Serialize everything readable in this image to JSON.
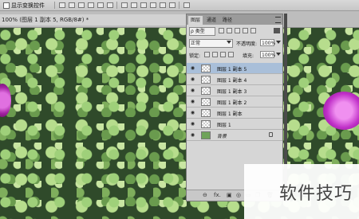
{
  "options_bar": {
    "label": "显示变换控件"
  },
  "document_tab": {
    "title": "100% (图层 1 副本 5, RGB/8#) *"
  },
  "panel": {
    "tabs": [
      "图层",
      "通道",
      "路径"
    ],
    "kind": "ρ 类型",
    "blend_mode": "正常",
    "opacity_label": "不透明度:",
    "opacity_value": "100%",
    "lock_label": "锁定:",
    "fill_label": "填充:",
    "fill_value": "100%",
    "layers": [
      {
        "name": "图层 1 副本 5",
        "selected": true
      },
      {
        "name": "图层 1 副本 4"
      },
      {
        "name": "图层 1 副本 3"
      },
      {
        "name": "图层 1 副本 2"
      },
      {
        "name": "图层 1 副本"
      },
      {
        "name": "图层 1"
      },
      {
        "name": "背景",
        "background": true
      }
    ],
    "footer_icons": [
      "⊖",
      "fx.",
      "▣",
      "◎",
      "▭",
      "❐",
      "🗑"
    ]
  },
  "watermark": {
    "text": "软件技巧"
  },
  "icons": {
    "visibility": "eye-icon",
    "lock": "lock-icon",
    "menu": "panel-menu-icon"
  }
}
